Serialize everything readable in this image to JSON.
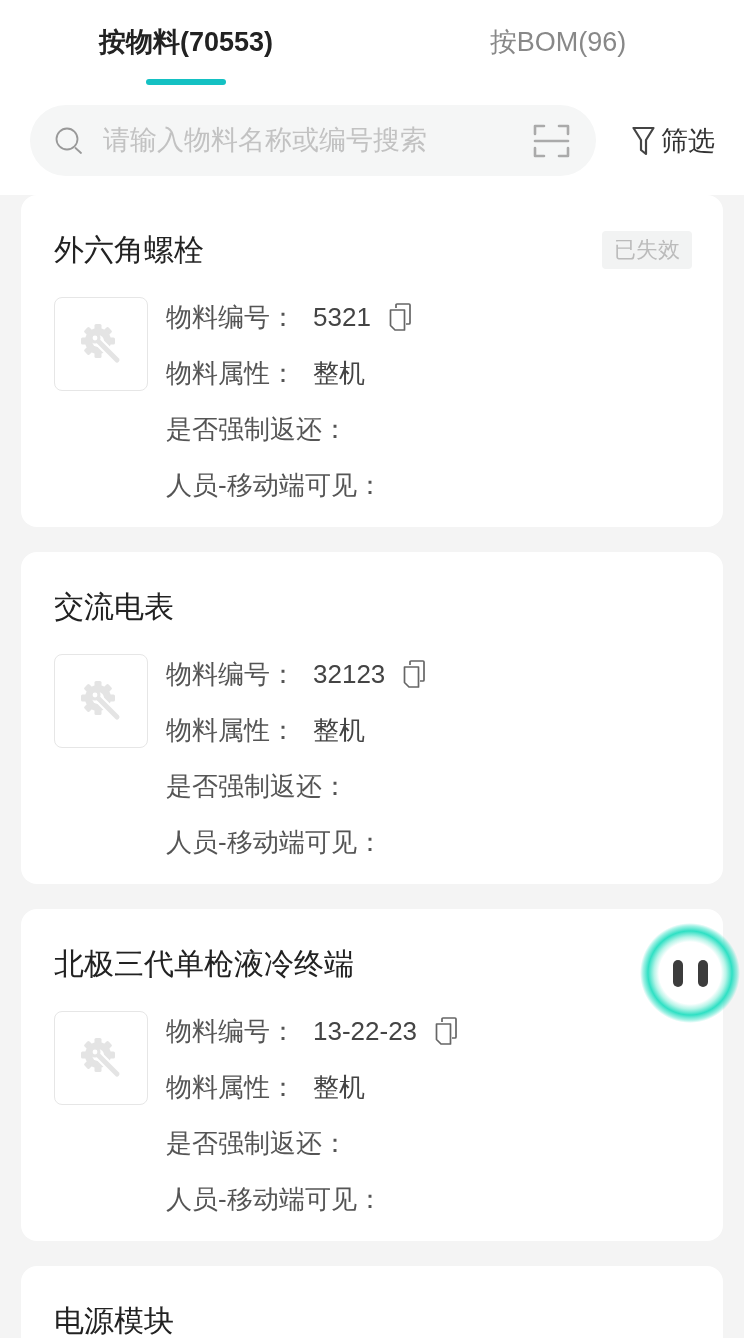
{
  "tabs": [
    {
      "label": "按物料(70553)",
      "selected": true
    },
    {
      "label": "按BOM(96)",
      "selected": false
    }
  ],
  "search": {
    "placeholder": "请输入物料名称或编号搜索"
  },
  "filter": {
    "label": "筛选"
  },
  "materials": [
    {
      "title": "外六角螺栓",
      "badge": "已失效",
      "fields": [
        {
          "label": "物料编号：",
          "value": "5321",
          "copyable": true
        },
        {
          "label": "物料属性：",
          "value": "整机",
          "copyable": false
        },
        {
          "label": "是否强制返还：",
          "copyable": false
        },
        {
          "label": "人员-移动端可见：",
          "copyable": false
        }
      ]
    },
    {
      "title": "交流电表",
      "fields": [
        {
          "label": "物料编号：",
          "value": "32123",
          "copyable": true
        },
        {
          "label": "物料属性：",
          "value": "整机",
          "copyable": false
        },
        {
          "label": "是否强制返还：",
          "copyable": false
        },
        {
          "label": "人员-移动端可见：",
          "copyable": false
        }
      ]
    },
    {
      "title": "北极三代单枪液冷终端",
      "fields": [
        {
          "label": "物料编号：",
          "value": "13-22-23",
          "copyable": true
        },
        {
          "label": "物料属性：",
          "value": "整机",
          "copyable": false
        },
        {
          "label": "是否强制返还：",
          "copyable": false
        },
        {
          "label": "人员-移动端可见：",
          "copyable": false
        }
      ]
    },
    {
      "title": "电源模块"
    }
  ]
}
